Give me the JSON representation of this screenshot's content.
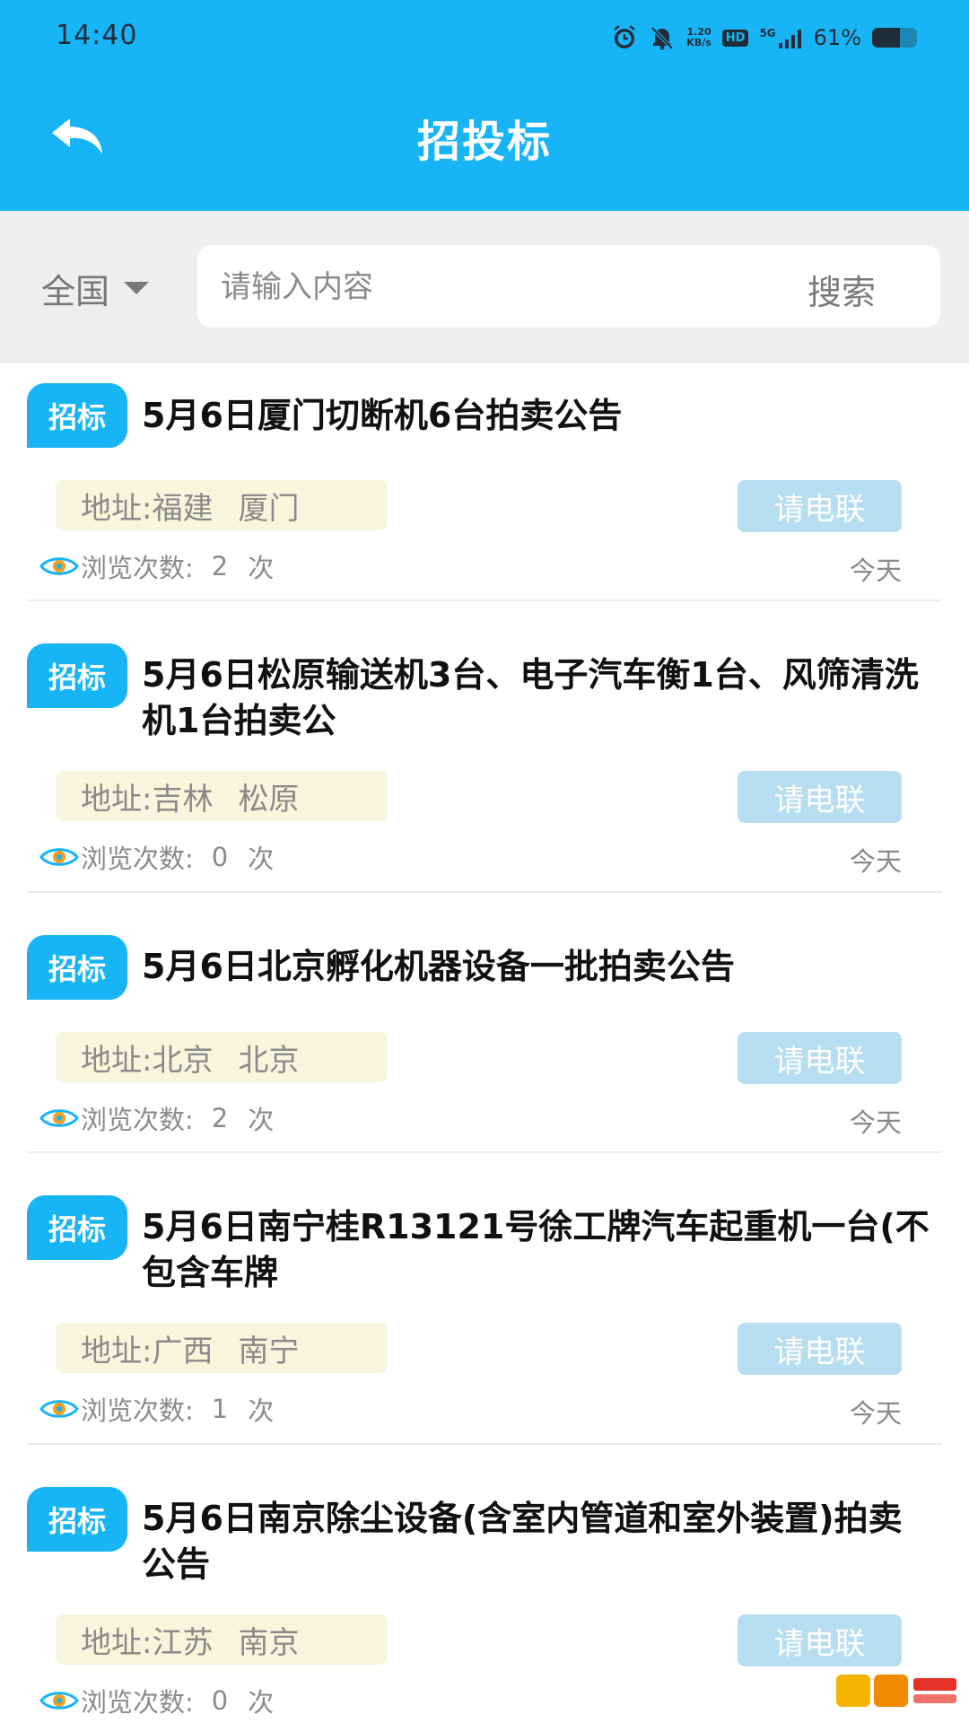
{
  "status_bar": {
    "time": "14:40",
    "net_speed_value": "1.20",
    "net_speed_unit": "KB/s",
    "hd": "HD",
    "signal": "5G",
    "battery_pct": "61%",
    "battery_level": 0.61
  },
  "header": {
    "title": "招投标"
  },
  "search": {
    "region": "全国",
    "placeholder": "请输入内容",
    "button_label": "搜索"
  },
  "labels": {
    "address_prefix": "地址:",
    "views_prefix": "浏览次数:",
    "views_suffix": "次"
  },
  "items": [
    {
      "tag": "招标",
      "title": "5月6日厦门切断机6台拍卖公告",
      "province": "福建",
      "city": "厦门",
      "call": "请电联",
      "views": "2",
      "date": "今天"
    },
    {
      "tag": "招标",
      "title": "5月6日松原输送机3台、电子汽车衡1台、风筛清洗机1台拍卖公",
      "province": "吉林",
      "city": "松原",
      "call": "请电联",
      "views": "0",
      "date": "今天"
    },
    {
      "tag": "招标",
      "title": "5月6日北京孵化机器设备一批拍卖公告",
      "province": "北京",
      "city": "北京",
      "call": "请电联",
      "views": "2",
      "date": "今天"
    },
    {
      "tag": "招标",
      "title": "5月6日南宁桂R13121号徐工牌汽车起重机一台(不包含车牌",
      "province": "广西",
      "city": "南宁",
      "call": "请电联",
      "views": "1",
      "date": "今天"
    },
    {
      "tag": "招标",
      "title": "5月6日南京除尘设备(含室内管道和室外装置)拍卖公告",
      "province": "江苏",
      "city": "南京",
      "call": "请电联",
      "views": "0",
      "date": ""
    }
  ]
}
